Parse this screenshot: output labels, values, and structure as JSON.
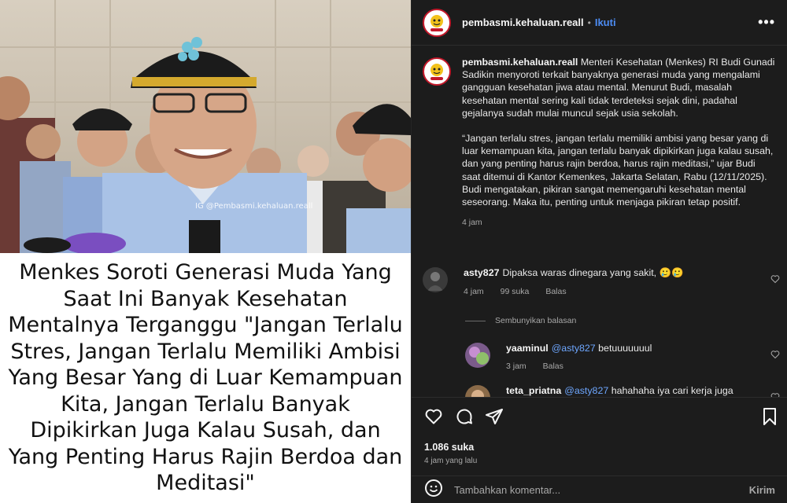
{
  "media": {
    "watermark": "IG @Pembasmi.kehaluan.reall",
    "headline": "Menkes Soroti Generasi Muda Yang Saat Ini Banyak Kesehatan Mentalnya Terganggu \"Jangan Terlalu Stres, Jangan Terlalu Memiliki Ambisi Yang Besar Yang di Luar Kemampuan Kita, Jangan Terlalu Banyak Dipikirkan Juga Kalau Susah, dan Yang Penting Harus Rajin Berdoa dan Meditasi\""
  },
  "header": {
    "username": "pembasmi.kehaluan.reall",
    "separator": "•",
    "follow_label": "Ikuti",
    "more_label": "•••"
  },
  "caption": {
    "username": "pembasmi.kehaluan.reall",
    "paragraph1": "Menteri Kesehatan (Menkes) RI Budi Gunadi Sadikin menyoroti terkait banyaknya generasi muda yang mengalami gangguan kesehatan jiwa atau mental. Menurut Budi, masalah kesehatan mental sering kali tidak terdeteksi sejak dini, padahal gejalanya sudah mulai muncul sejak usia sekolah.",
    "paragraph2": "“Jangan terlalu stres, jangan terlalu memiliki ambisi yang besar yang di luar kemampuan kita, jangan terlalu banyak dipikirkan juga kalau susah, dan yang penting harus rajin berdoa, harus rajin meditasi,” ujar Budi saat ditemui di Kantor Kemenkes, Jakarta Selatan, Rabu (12/11/2025). Budi mengatakan, pikiran sangat memengaruhi kesehatan mental seseorang. Maka itu, penting untuk menjaga pikiran tetap positif.",
    "time": "4 jam"
  },
  "comments": [
    {
      "username": "asty827",
      "text": "Dipaksa waras dinegara yang sakit, 🥲🥲",
      "time": "4 jam",
      "likes": "99 suka",
      "reply_label": "Balas"
    }
  ],
  "hide_replies_label": "Sembunyikan balasan",
  "replies": [
    {
      "username": "yaaminul",
      "mention": "@asty827",
      "text": "betuuuuuuul",
      "time": "3 jam",
      "reply_label": "Balas"
    },
    {
      "username": "teta_priatna",
      "mention": "@asty827",
      "text": "hahahaha iya cari kerja juga"
    }
  ],
  "stats": {
    "likes": "1.086 suka",
    "time_ago": "4 jam yang lalu"
  },
  "composer": {
    "placeholder": "Tambahkan komentar...",
    "send_label": "Kirim"
  },
  "icons": [
    "heart-icon",
    "comment-icon",
    "share-icon",
    "bookmark-icon",
    "emoji-icon",
    "more-icon"
  ],
  "colors": {
    "panel_bg": "#1c1c1c",
    "link_blue": "#4d8df5",
    "mention_blue": "#6ea7ff",
    "muted_text": "#a8a8a8"
  }
}
